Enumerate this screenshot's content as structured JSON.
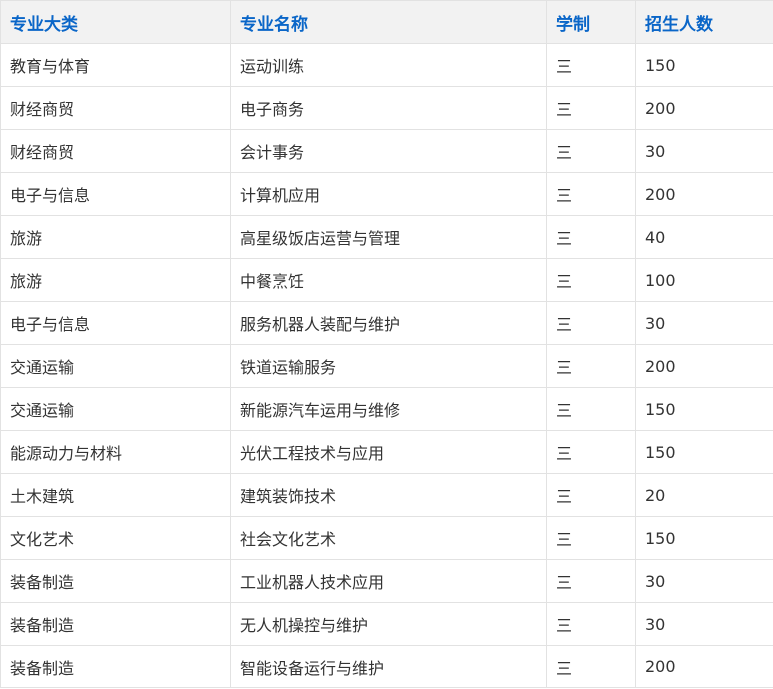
{
  "table": {
    "headers": [
      "专业大类",
      "专业名称",
      "学制",
      "招生人数"
    ],
    "rows": [
      [
        "教育与体育",
        "运动训练",
        "三",
        "150"
      ],
      [
        "财经商贸",
        "电子商务",
        "三",
        "200"
      ],
      [
        "财经商贸",
        "会计事务",
        "三",
        "30"
      ],
      [
        "电子与信息",
        "计算机应用",
        "三",
        "200"
      ],
      [
        "旅游",
        "高星级饭店运营与管理",
        "三",
        "40"
      ],
      [
        "旅游",
        "中餐烹饪",
        "三",
        "100"
      ],
      [
        "电子与信息",
        "服务机器人装配与维护",
        "三",
        "30"
      ],
      [
        "交通运输",
        "铁道运输服务",
        "三",
        "200"
      ],
      [
        "交通运输",
        "新能源汽车运用与维修",
        "三",
        "150"
      ],
      [
        "能源动力与材料",
        "光伏工程技术与应用",
        "三",
        "150"
      ],
      [
        "土木建筑",
        "建筑装饰技术",
        "三",
        "20"
      ],
      [
        "文化艺术",
        "社会文化艺术",
        "三",
        "150"
      ],
      [
        "装备制造",
        "工业机器人技术应用",
        "三",
        "30"
      ],
      [
        "装备制造",
        "无人机操控与维护",
        "三",
        "30"
      ],
      [
        "装备制造",
        "智能设备运行与维护",
        "三",
        "200"
      ]
    ]
  }
}
